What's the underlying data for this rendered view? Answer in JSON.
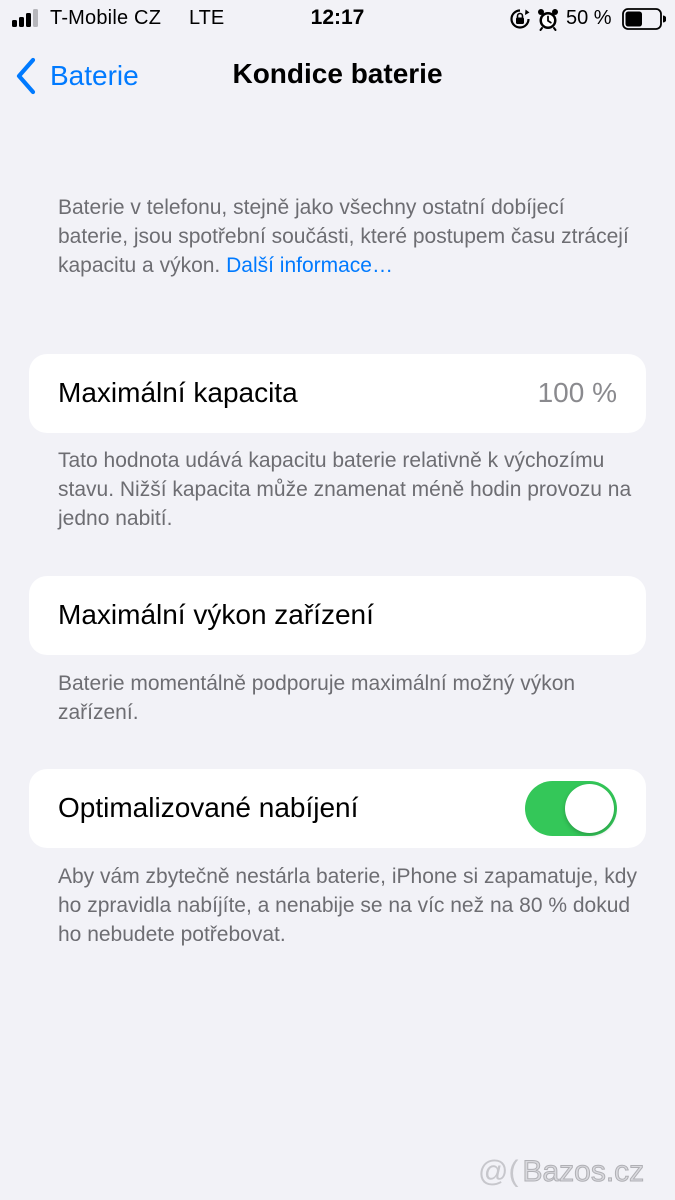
{
  "status_bar": {
    "carrier": "T-Mobile CZ",
    "network": "LTE",
    "time": "12:17",
    "battery_percent": "50 %",
    "battery_level": 0.5,
    "signal_bars": 3,
    "signal_bars_total": 4,
    "icons": [
      "signal-icon",
      "rotation-lock-icon",
      "alarm-icon",
      "battery-icon"
    ]
  },
  "nav": {
    "back_label": "Baterie",
    "title": "Kondice baterie"
  },
  "intro": {
    "text": "Baterie v telefonu, stejně jako všechny ostatní dobíjecí baterie, jsou spotřební součásti, které postupem času ztrácejí kapacitu a výkon. ",
    "link": "Další informace…"
  },
  "max_capacity": {
    "label": "Maximální kapacita",
    "value": "100 %",
    "footer": "Tato hodnota udává kapacitu baterie relativně k výchozímu stavu. Nižší kapacita může znamenat méně hodin provozu na jedno nabití."
  },
  "peak_performance": {
    "label": "Maximální výkon zařízení",
    "footer": "Baterie momentálně podporuje maximální možný výkon zařízení."
  },
  "optimized_charging": {
    "label": "Optimalizované nabíjení",
    "enabled": true,
    "footer": "Aby vám zbytečně nestárla baterie, iPhone si zapamatuje, kdy ho zpravidla nabíjíte, a nenabije se na víc než na 80 % dokud ho nebudete potřebovat."
  },
  "colors": {
    "background": "#f2f2f7",
    "card": "#ffffff",
    "accent": "#007aff",
    "toggle_on": "#34c759",
    "secondary_text": "#6d6d72"
  },
  "watermark": {
    "symbol": "@(",
    "text": "Bazos.cz"
  }
}
